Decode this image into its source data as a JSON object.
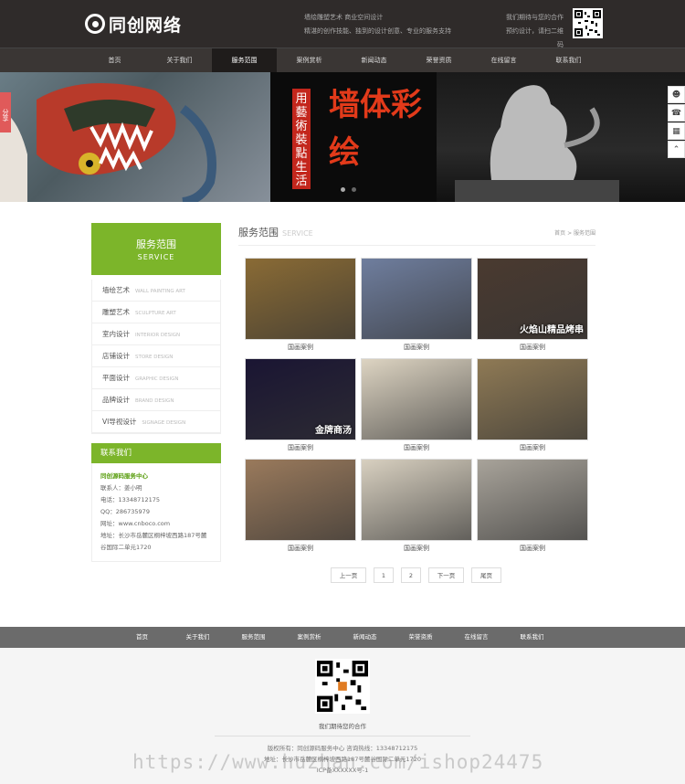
{
  "header": {
    "logo_text": "同创网络",
    "slogan_line1": "墙绘雕塑艺术 商业空间设计",
    "slogan_line2": "精湛的创作技能、独到的设计创意、专业的服务支持",
    "contact_line1": "我们期待与您的合作",
    "contact_line2": "预约设计，请扫二维码"
  },
  "nav": {
    "items": [
      "首页",
      "关于我们",
      "服务范围",
      "案例赏析",
      "新闻动态",
      "荣誉资质",
      "在线留言",
      "联系我们"
    ],
    "active_index": 2
  },
  "banner": {
    "poster_vertical": "用藝術裝點生活",
    "poster_big": "墙体彩绘",
    "share_label": "分享",
    "slide_count": 2,
    "active_slide": 1
  },
  "sidebar": {
    "title": "服务范围",
    "title_en": "SERVICE",
    "items": [
      {
        "label": "墙绘艺术",
        "en": "WALL PAINTING ART"
      },
      {
        "label": "雕塑艺术",
        "en": "SCULPTURE ART"
      },
      {
        "label": "室内设计",
        "en": "INTERIOR DESIGN"
      },
      {
        "label": "店铺设计",
        "en": "STORE DESIGN"
      },
      {
        "label": "平面设计",
        "en": "GRAPHIC DESIGN"
      },
      {
        "label": "品牌设计",
        "en": "BRAND DESIGN"
      },
      {
        "label": "VI导视设计",
        "en": "SIGNAGE DESIGN"
      }
    ],
    "contact_title": "联系我们",
    "contact": {
      "company": "同创源码服务中心",
      "person": "联系人：姜小明",
      "phone": "电话：13348712175",
      "qq": "QQ：286735979",
      "site": "网址：www.cnboco.com",
      "address": "地址：长沙市岳麓区桐梓坡西路187号麓谷国际二单元1720"
    }
  },
  "main": {
    "title": "服务范围",
    "title_en": "SERVICE",
    "breadcrumb": "首页 > 服务范围",
    "cases": [
      {
        "caption": "国画案例",
        "color": "#8a6b35"
      },
      {
        "caption": "国画案例",
        "color": "#6f7e9e"
      },
      {
        "caption": "国画案例",
        "color": "#4a3a30",
        "overlay": "火焰山精品烤串"
      },
      {
        "caption": "国画案例",
        "color": "#1a1533",
        "overlay": "金牌商汤"
      },
      {
        "caption": "国画案例",
        "color": "#ddd4c2"
      },
      {
        "caption": "国画案例",
        "color": "#8f7a55"
      },
      {
        "caption": "国画案例",
        "color": "#9a7a5c"
      },
      {
        "caption": "国画案例",
        "color": "#d8d0c0"
      },
      {
        "caption": "国画案例",
        "color": "#a8a39a"
      }
    ],
    "pager": {
      "prev": "上一页",
      "pages": [
        "1",
        "2"
      ],
      "next": "下一页",
      "last": "尾页"
    }
  },
  "footer": {
    "nav": [
      "首页",
      "关于我们",
      "服务范围",
      "案例赏析",
      "新闻动态",
      "荣誉资质",
      "在线留言",
      "联系我们"
    ],
    "invite": "我们期待您的合作",
    "copyright": "版权所有：同创源码服务中心    咨询热线：13348712175",
    "address": "地址：长沙市岳麓区桐梓坡西路187号麓谷国际二单元1720",
    "icp": "ICP备XXXXXX号-1"
  },
  "watermark": "https://www.huzhan.com/ishop24475",
  "colors": {
    "accent": "#7cb52a",
    "header_bg": "#2f2b2a",
    "footer_nav": "#6b6b6b"
  }
}
